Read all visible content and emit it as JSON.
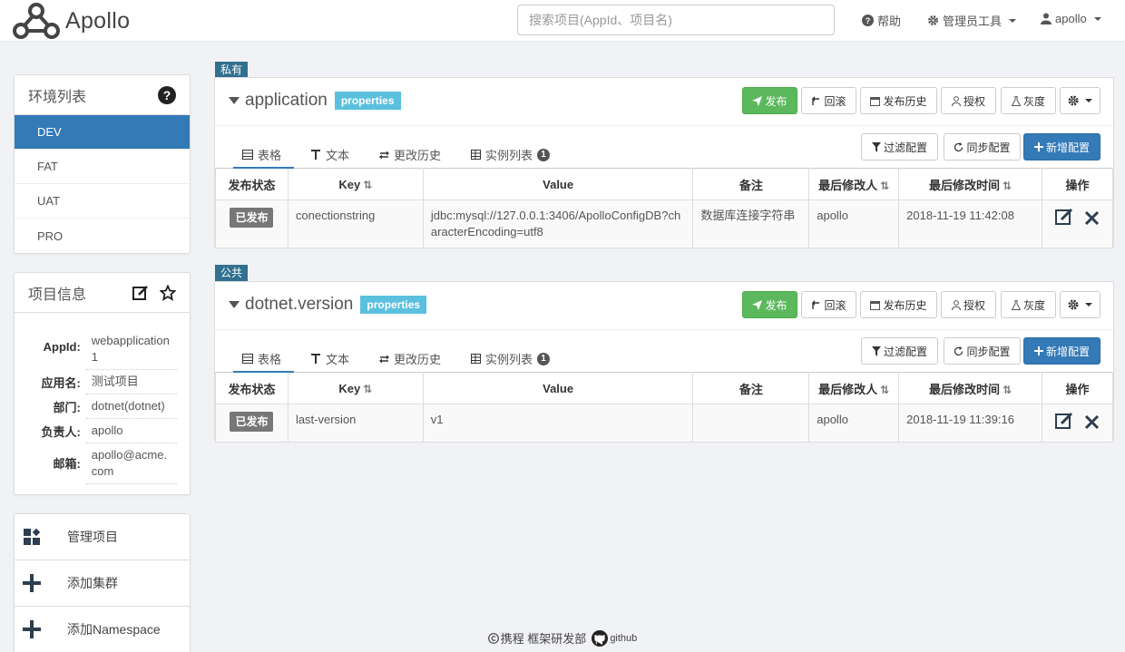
{
  "nav": {
    "logo_text": "Apollo",
    "search_placeholder": "搜索项目(AppId、项目名)",
    "help": "帮助",
    "admin_tools": "管理员工具",
    "user": "apollo"
  },
  "env": {
    "title": "环境列表",
    "items": [
      "DEV",
      "FAT",
      "UAT",
      "PRO"
    ],
    "active": "DEV"
  },
  "project": {
    "title": "项目信息",
    "rows": [
      {
        "label": "AppId:",
        "value": "webapplication1"
      },
      {
        "label": "应用名:",
        "value": "测试项目"
      },
      {
        "label": "部门:",
        "value": "dotnet(dotnet)"
      },
      {
        "label": "负责人:",
        "value": "apollo"
      },
      {
        "label": "邮箱:",
        "value": "apollo@acme.com"
      }
    ]
  },
  "actions": {
    "manage": "管理项目",
    "add_cluster": "添加集群",
    "add_namespace": "添加Namespace"
  },
  "namespaces": [
    {
      "scope": "私有",
      "name": "application",
      "format": "properties",
      "buttons": {
        "publish": "发布",
        "rollback": "回滚",
        "history": "发布历史",
        "grant": "授权",
        "gray": "灰度"
      },
      "tabs": {
        "table": "表格",
        "text": "文本",
        "changes": "更改历史",
        "instances": "实例列表",
        "instance_count": "1"
      },
      "tools": {
        "filter": "过滤配置",
        "sync": "同步配置",
        "add": "新增配置"
      },
      "columns": [
        "发布状态",
        "Key",
        "Value",
        "备注",
        "最后修改人",
        "最后修改时间",
        "操作"
      ],
      "rows": [
        {
          "status": "已发布",
          "key": "conectionstring",
          "value": "jdbc:mysql://127.0.0.1:3406/ApolloConfigDB?characterEncoding=utf8",
          "comment": "数据库连接字符串",
          "modifier": "apollo",
          "time": "2018-11-19 11:42:08"
        }
      ]
    },
    {
      "scope": "公共",
      "name": "dotnet.version",
      "format": "properties",
      "buttons": {
        "publish": "发布",
        "rollback": "回滚",
        "history": "发布历史",
        "grant": "授权",
        "gray": "灰度"
      },
      "tabs": {
        "table": "表格",
        "text": "文本",
        "changes": "更改历史",
        "instances": "实例列表",
        "instance_count": "1"
      },
      "tools": {
        "filter": "过滤配置",
        "sync": "同步配置",
        "add": "新增配置"
      },
      "columns": [
        "发布状态",
        "Key",
        "Value",
        "备注",
        "最后修改人",
        "最后修改时间",
        "操作"
      ],
      "rows": [
        {
          "status": "已发布",
          "key": "last-version",
          "value": "v1",
          "comment": "",
          "modifier": "apollo",
          "time": "2018-11-19 11:39:16"
        }
      ]
    }
  ],
  "footer": {
    "company": "携程 框架研发部",
    "github": "github"
  }
}
